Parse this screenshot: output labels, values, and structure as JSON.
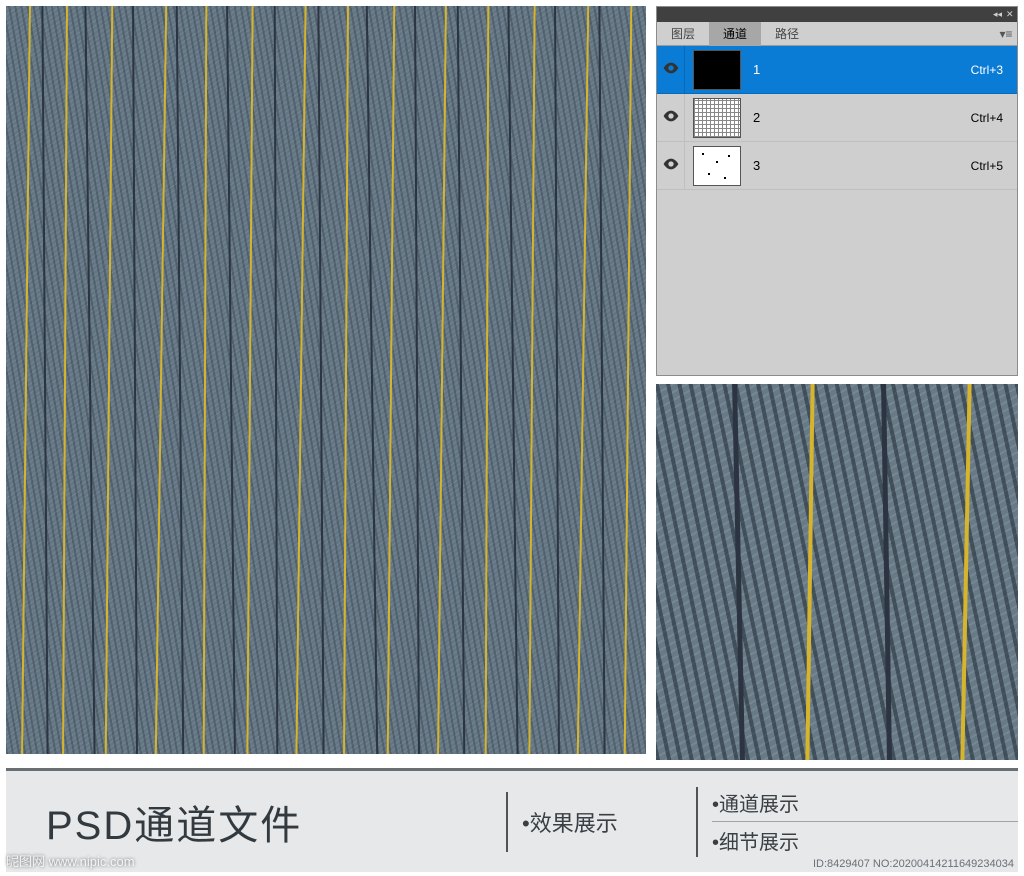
{
  "panel": {
    "tabs": [
      {
        "label": "图层",
        "active": false
      },
      {
        "label": "通道",
        "active": true
      },
      {
        "label": "路径",
        "active": false
      }
    ],
    "channels": [
      {
        "name": "1",
        "shortcut": "Ctrl+3",
        "selected": true,
        "thumb": "black"
      },
      {
        "name": "2",
        "shortcut": "Ctrl+4",
        "selected": false,
        "thumb": "grid"
      },
      {
        "name": "3",
        "shortcut": "Ctrl+5",
        "selected": false,
        "thumb": "dots"
      }
    ]
  },
  "bottom": {
    "title": "PSD通道文件",
    "mid": "•效果展示",
    "right1": "•通道展示",
    "right2": "•细节展示"
  },
  "watermark": {
    "left": "昵图网 www.nipic.com",
    "right": "ID:8429407 NO:20200414211649234034"
  },
  "texture": {
    "base_color": "#647684",
    "stripe_yellow": "#d6b52d",
    "stripe_dark": "#2b3440"
  }
}
